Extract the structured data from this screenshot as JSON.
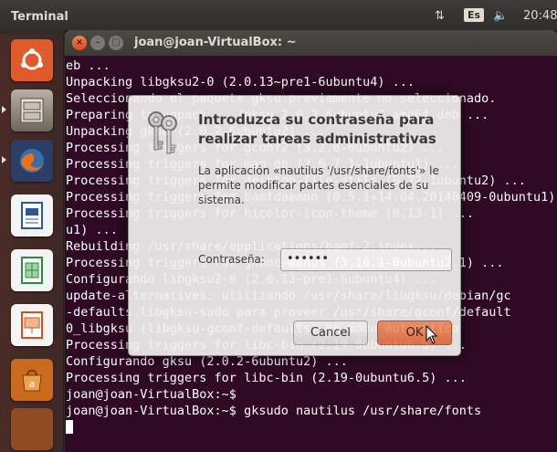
{
  "panel": {
    "title": "Terminal",
    "keyboard_layout": "Es",
    "clock": "20:48",
    "icons": [
      "network-icon",
      "keyboard-layout-icon",
      "sound-icon"
    ]
  },
  "launcher": {
    "items": [
      {
        "name": "ubuntu-dash",
        "icon": "ubuntu-logo-icon",
        "color": "#e05a2b"
      },
      {
        "name": "files",
        "icon": "file-cabinet-icon",
        "color": "#8a8175"
      },
      {
        "name": "firefox",
        "icon": "firefox-icon",
        "color": "#3a6ea8"
      },
      {
        "name": "libreoffice-writer",
        "icon": "writer-document-icon",
        "color": "#2a5a9a"
      },
      {
        "name": "libreoffice-calc",
        "icon": "calc-spreadsheet-icon",
        "color": "#2e8a3e"
      },
      {
        "name": "libreoffice-impress",
        "icon": "impress-presentation-icon",
        "color": "#c8561e"
      },
      {
        "name": "software-center",
        "icon": "shopping-bag-icon",
        "color": "#d47a2a"
      }
    ]
  },
  "terminal": {
    "title": "joan@joan-VirtualBox: ~",
    "buttons": {
      "close": "×",
      "minimize": "–",
      "maximize": "□"
    },
    "lines": [
      "eb ...",
      "Unpacking libgksu2-0 (2.0.13~pre1-6ubuntu4) ...",
      "Seleccionando el paquete gksu previamente no seleccionado.",
      "Preparing to unpack .../gksu_2.0.2-6ubuntu2_amd64.deb ...",
      "Unpacking gksu (2.0.2-6ubuntu2) ...",
      "Processing triggers for gconf2 (3.2.6-0ubuntu2) ...",
      "Processing triggers for man-db (2.6.7.1-1ubuntu1) ...",
      "Processing triggers for desktop-file-utils (0.22-1ubuntu2) ...",
      "Processing triggers for bamfdaemon (0.5.1+14.04.20140409-0ubuntu1) ...",
      "Processing triggers for hicolor-icon-theme (0.13-1) ...",
      "u1) ...",
      "Rebuilding /usr/share/applications/bamf-2.index...",
      "Processing triggers for gnome-menus (3.10.1-0ubuntu2.1) ...",
      "Configurando libgksu2-0 (2.0.13~pre1-6ubuntu4) ...",
      "update-alternatives: utilizando /usr/share/libgksu/debian/gc",
      "-defaults.libgksu-sudo para proveer /usr/share/gconf/default",
      "0_libgksu (libgksu-gconf-defaults) en modo automático",
      "Processing triggers for libc-bin (2.19-0ubuntu6.5) ...",
      "Configurando gksu (2.0.2-6ubuntu2) ...",
      "Processing triggers for libc-bin (2.19-0ubuntu6.5) ...",
      "joan@joan-VirtualBox:~$",
      "joan@joan-VirtualBox:~$ gksudo nautilus /usr/share/fonts"
    ]
  },
  "dialog": {
    "title": "Introduzca su contraseña para realizar tareas administrativas",
    "message": "La aplicación «nautilus '/usr/share/fonts'» le permite modificar partes esenciales de su sistema.",
    "password_label": "Contraseña:",
    "password_value": "••••••",
    "cancel_label": "Cancel",
    "ok_label": "OK",
    "ok_color": "#e8784a"
  }
}
